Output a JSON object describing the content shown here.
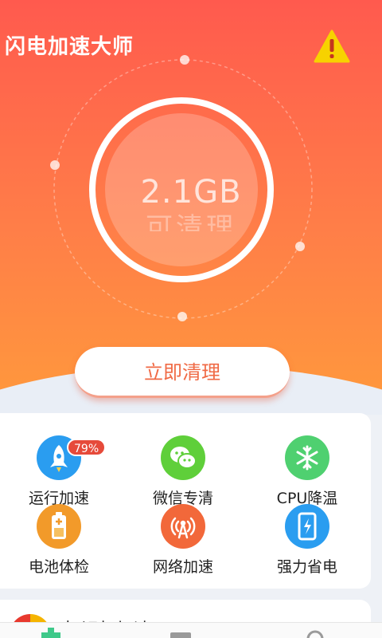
{
  "app": {
    "title": "闪电加速大师"
  },
  "header": {
    "warning_icon": "warning-triangle-icon"
  },
  "gauge": {
    "value": "2.1GB",
    "caption": "可清理"
  },
  "actions": {
    "clean_label": "立即清理"
  },
  "tools": [
    {
      "label": "运行加速",
      "icon": "rocket-icon",
      "color": "#2a9df0",
      "badge": "79%"
    },
    {
      "label": "微信专清",
      "icon": "wechat-icon",
      "color": "#5fcf3a"
    },
    {
      "label": "CPU降温",
      "icon": "snowflake-icon",
      "color": "#4fd070"
    },
    {
      "label": "电池体检",
      "icon": "battery-icon",
      "color": "#f29a2a"
    },
    {
      "label": "网络加速",
      "icon": "signal-tower-icon",
      "color": "#f2683a"
    },
    {
      "label": "强力省电",
      "icon": "phone-power-icon",
      "color": "#2a9df0"
    }
  ],
  "feature_card": {
    "text": "标识灯加速"
  },
  "tabbar": {
    "items": [
      "home-tab-icon",
      "media-tab-icon",
      "search-tab-icon"
    ]
  },
  "colors": {
    "accent": "#f06a45",
    "hero_top": "#ff5a4e",
    "hero_bottom": "#ff9a3c",
    "warning": "#f7d200"
  }
}
